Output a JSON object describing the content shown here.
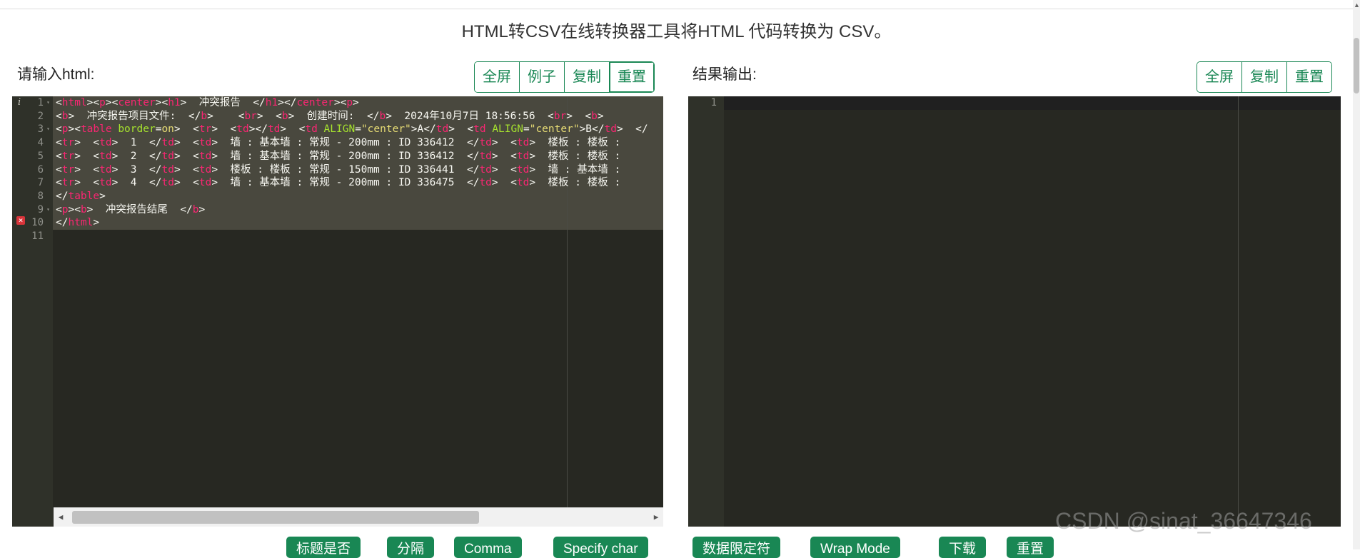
{
  "page": {
    "title": "HTML转CSV在线转换器工具将HTML 代码转换为 CSV。"
  },
  "input_panel": {
    "label": "请输入html:",
    "buttons": [
      "全屏",
      "例子",
      "复制",
      "重置"
    ],
    "lines": [
      "<html><p><center><h1>  冲突报告  </h1></center><p>",
      "<b>  冲突报告项目文件:  </b>    <br>  <b>  创建时间:  </b>  2024年10月7日 18:56:56  <br>  <b>",
      "<p><table border=on>  <tr>  <td></td>  <td ALIGN=\"center\">A</td>  <td ALIGN=\"center\">B</td>  </",
      "<tr>  <td>  1  </td>  <td>  墙 : 基本墙 : 常规 - 200mm : ID 336412  </td>  <td>  楼板 : 楼板 :",
      "<tr>  <td>  2  </td>  <td>  墙 : 基本墙 : 常规 - 200mm : ID 336412  </td>  <td>  楼板 : 楼板 :",
      "<tr>  <td>  3  </td>  <td>  楼板 : 楼板 : 常规 - 150mm : ID 336441  </td>  <td>  墙 : 基本墙 :",
      "<tr>  <td>  4  </td>  <td>  墙 : 基本墙 : 常规 - 200mm : ID 336475  </td>  <td>  楼板 : 楼板 :",
      "</table>",
      "<p><b>  冲突报告结尾  </b>",
      "</html>",
      ""
    ],
    "line_numbers": [
      "1",
      "2",
      "3",
      "4",
      "5",
      "6",
      "7",
      "8",
      "9",
      "10",
      "11"
    ],
    "info_marker": "i",
    "error_marker": "×"
  },
  "output_panel": {
    "label": "结果输出:",
    "buttons": [
      "全屏",
      "复制",
      "重置"
    ],
    "line_numbers": [
      "1"
    ]
  },
  "bottom_buttons": [
    "标题是否",
    "分隔",
    "Comma",
    "Specify char",
    "数据限定符",
    "Wrap Mode",
    "下载",
    "重置"
  ],
  "watermark": "CSDN @sinat_36647346",
  "colors": {
    "accent": "#198754",
    "editor_bg": "#272822",
    "tag": "#f92672",
    "attr": "#a6e22e",
    "string": "#e6db74"
  }
}
